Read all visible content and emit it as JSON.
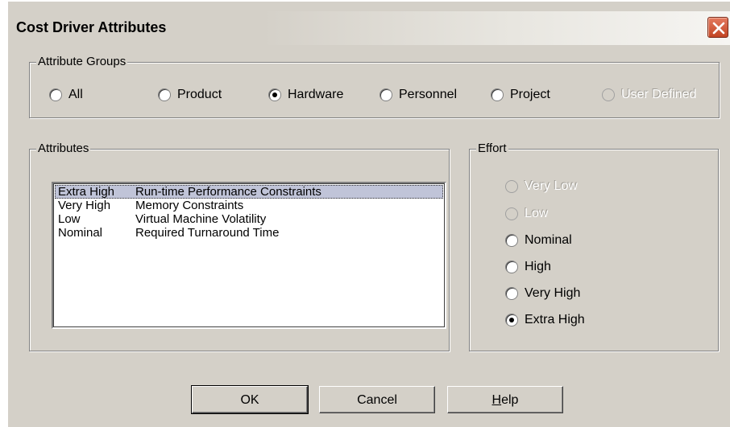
{
  "window": {
    "title": "Cost Driver Attributes"
  },
  "attribute_groups": {
    "legend": "Attribute Groups",
    "options": [
      {
        "label": "All",
        "checked": false,
        "enabled": true
      },
      {
        "label": "Product",
        "checked": false,
        "enabled": true
      },
      {
        "label": "Hardware",
        "checked": true,
        "enabled": true
      },
      {
        "label": "Personnel",
        "checked": false,
        "enabled": true
      },
      {
        "label": "Project",
        "checked": false,
        "enabled": true
      },
      {
        "label": "User Defined",
        "checked": false,
        "enabled": false
      }
    ]
  },
  "attributes": {
    "legend": "Attributes",
    "rows": [
      {
        "level": "Extra High",
        "name": "Run-time Performance Constraints",
        "selected": true
      },
      {
        "level": "Very High",
        "name": "Memory Constraints",
        "selected": false
      },
      {
        "level": "Low",
        "name": "Virtual Machine Volatility",
        "selected": false
      },
      {
        "level": "Nominal",
        "name": "Required Turnaround Time",
        "selected": false
      }
    ]
  },
  "effort": {
    "legend": "Effort",
    "options": [
      {
        "label": "Very Low",
        "checked": false,
        "enabled": false
      },
      {
        "label": "Low",
        "checked": false,
        "enabled": false
      },
      {
        "label": "Nominal",
        "checked": false,
        "enabled": true
      },
      {
        "label": "High",
        "checked": false,
        "enabled": true
      },
      {
        "label": "Very High",
        "checked": false,
        "enabled": true
      },
      {
        "label": "Extra High",
        "checked": true,
        "enabled": true
      }
    ]
  },
  "buttons": {
    "ok": "OK",
    "cancel": "Cancel",
    "help_mnemonic": "H",
    "help_rest": "elp"
  },
  "colors": {
    "dialog_bg": "#d4d0c8",
    "close_button": "#c24524",
    "selection": "#c0c4d8"
  }
}
